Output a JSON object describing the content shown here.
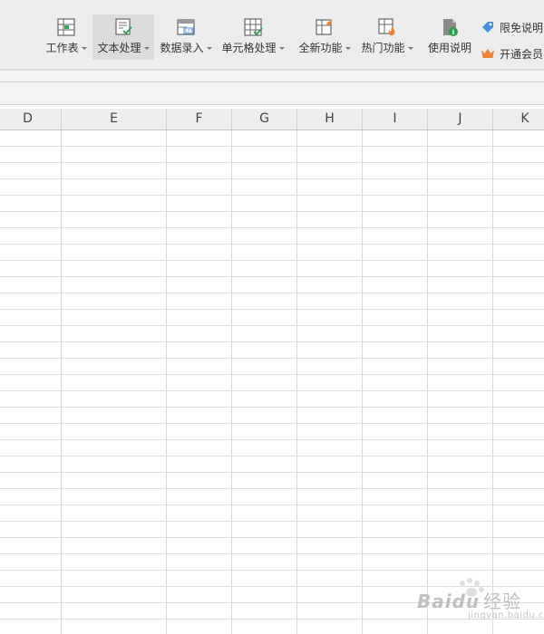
{
  "toolbar": {
    "tools": [
      {
        "label": "工作表",
        "icon": "worksheet-icon",
        "dropdown": true
      },
      {
        "label": "文本处理",
        "icon": "text-process-icon",
        "dropdown": true,
        "active": true
      },
      {
        "label": "数据录入",
        "icon": "data-entry-icon",
        "dropdown": true
      },
      {
        "label": "单元格处理",
        "icon": "cell-process-icon",
        "dropdown": true
      },
      {
        "label": "全新功能",
        "icon": "new-features-icon",
        "dropdown": true
      },
      {
        "label": "热门功能",
        "icon": "hot-features-icon",
        "dropdown": true
      },
      {
        "label": "使用说明",
        "icon": "usage-guide-icon",
        "dropdown": false
      }
    ],
    "promo_free": "限免说明",
    "promo_vip": "开通会员"
  },
  "grid": {
    "columns": [
      "D",
      "E",
      "F",
      "G",
      "H",
      "I",
      "J",
      "K"
    ]
  },
  "watermark": {
    "brand": "Baidu",
    "brand_cn": "经验",
    "url": "jingyan.baidu.com"
  },
  "colors": {
    "toolbar_bg": "#ededed",
    "header_bg": "#eeeeee",
    "gridline": "#dddddd",
    "accent_green": "#2e9e4a",
    "accent_blue": "#4a90d9",
    "accent_orange": "#e8833a"
  }
}
